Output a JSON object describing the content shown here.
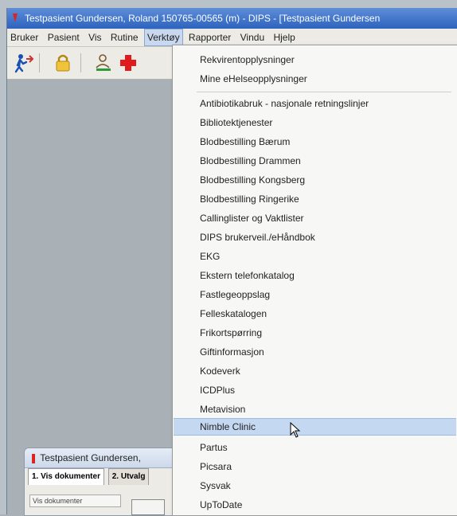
{
  "window": {
    "title": "Testpasient Gundersen, Roland  150765-00565 (m) - DIPS - [Testpasient Gundersen"
  },
  "menubar": {
    "items": [
      "Bruker",
      "Pasient",
      "Vis",
      "Rutine",
      "Verktøy",
      "Rapporter",
      "Vindu",
      "Hjelp"
    ],
    "active": "Verktøy"
  },
  "toolbar": {
    "icons": [
      "person-run-icon",
      "lock-icon",
      "user-edit-icon",
      "red-cross-icon"
    ]
  },
  "dropdown": {
    "group1": [
      "Rekvirentopplysninger",
      "Mine eHelseopplysninger"
    ],
    "group2": [
      "Antibiotikabruk - nasjonale retningslinjer",
      "Bibliotektjenester",
      "Blodbestilling Bærum",
      "Blodbestilling Drammen",
      "Blodbestilling Kongsberg",
      "Blodbestilling Ringerike",
      "Callinglister og Vaktlister",
      "DIPS brukerveil./eHåndbok",
      "EKG",
      "Ekstern telefonkatalog",
      "Fastlegeoppslag",
      "Felleskatalogen",
      "Frikortspørring",
      "Giftinformasjon",
      "Kodeverk",
      "ICDPlus",
      "Metavision",
      "Nimble Clinic",
      "Partus",
      "Picsara",
      "Sysvak",
      "UpToDate"
    ],
    "hovered": "Nimble Clinic"
  },
  "subwindow": {
    "title": "Testpasient Gundersen,",
    "tabs": [
      "1. Vis dokumenter",
      "2. Utvalg"
    ],
    "field_label": "Vis dokumenter"
  },
  "colors": {
    "titlebar": "#2d63bf",
    "menu_hover": "#c5d8f1",
    "workspace": "#a9b1b6"
  }
}
